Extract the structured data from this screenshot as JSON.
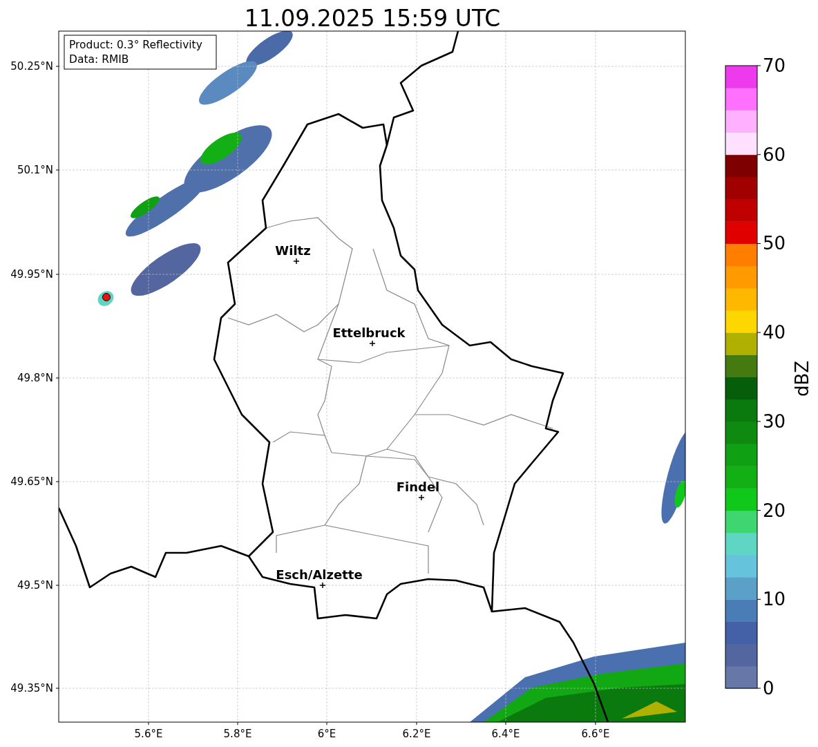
{
  "title": "11.09.2025 15:59 UTC",
  "info_box": {
    "lines": [
      "Product: 0.3° Reflectivity",
      "Data: RMIB"
    ]
  },
  "map": {
    "latitude_labels": [
      "50.25°N",
      "50.1°N",
      "49.95°N",
      "49.8°N",
      "49.65°N",
      "49.5°N",
      "49.35°N"
    ],
    "longitude_labels": [
      "5.6°E",
      "5.8°E",
      "6°E",
      "6.2°E",
      "6.4°E",
      "6.6°E"
    ],
    "cities": [
      {
        "name": "Wiltz"
      },
      {
        "name": "Ettelbruck"
      },
      {
        "name": "Findel"
      },
      {
        "name": "Esch/Alzette"
      }
    ]
  },
  "colorbar": {
    "label": "dBZ",
    "ticks": [
      "70",
      "60",
      "50",
      "40",
      "30",
      "20",
      "10",
      "0"
    ]
  }
}
